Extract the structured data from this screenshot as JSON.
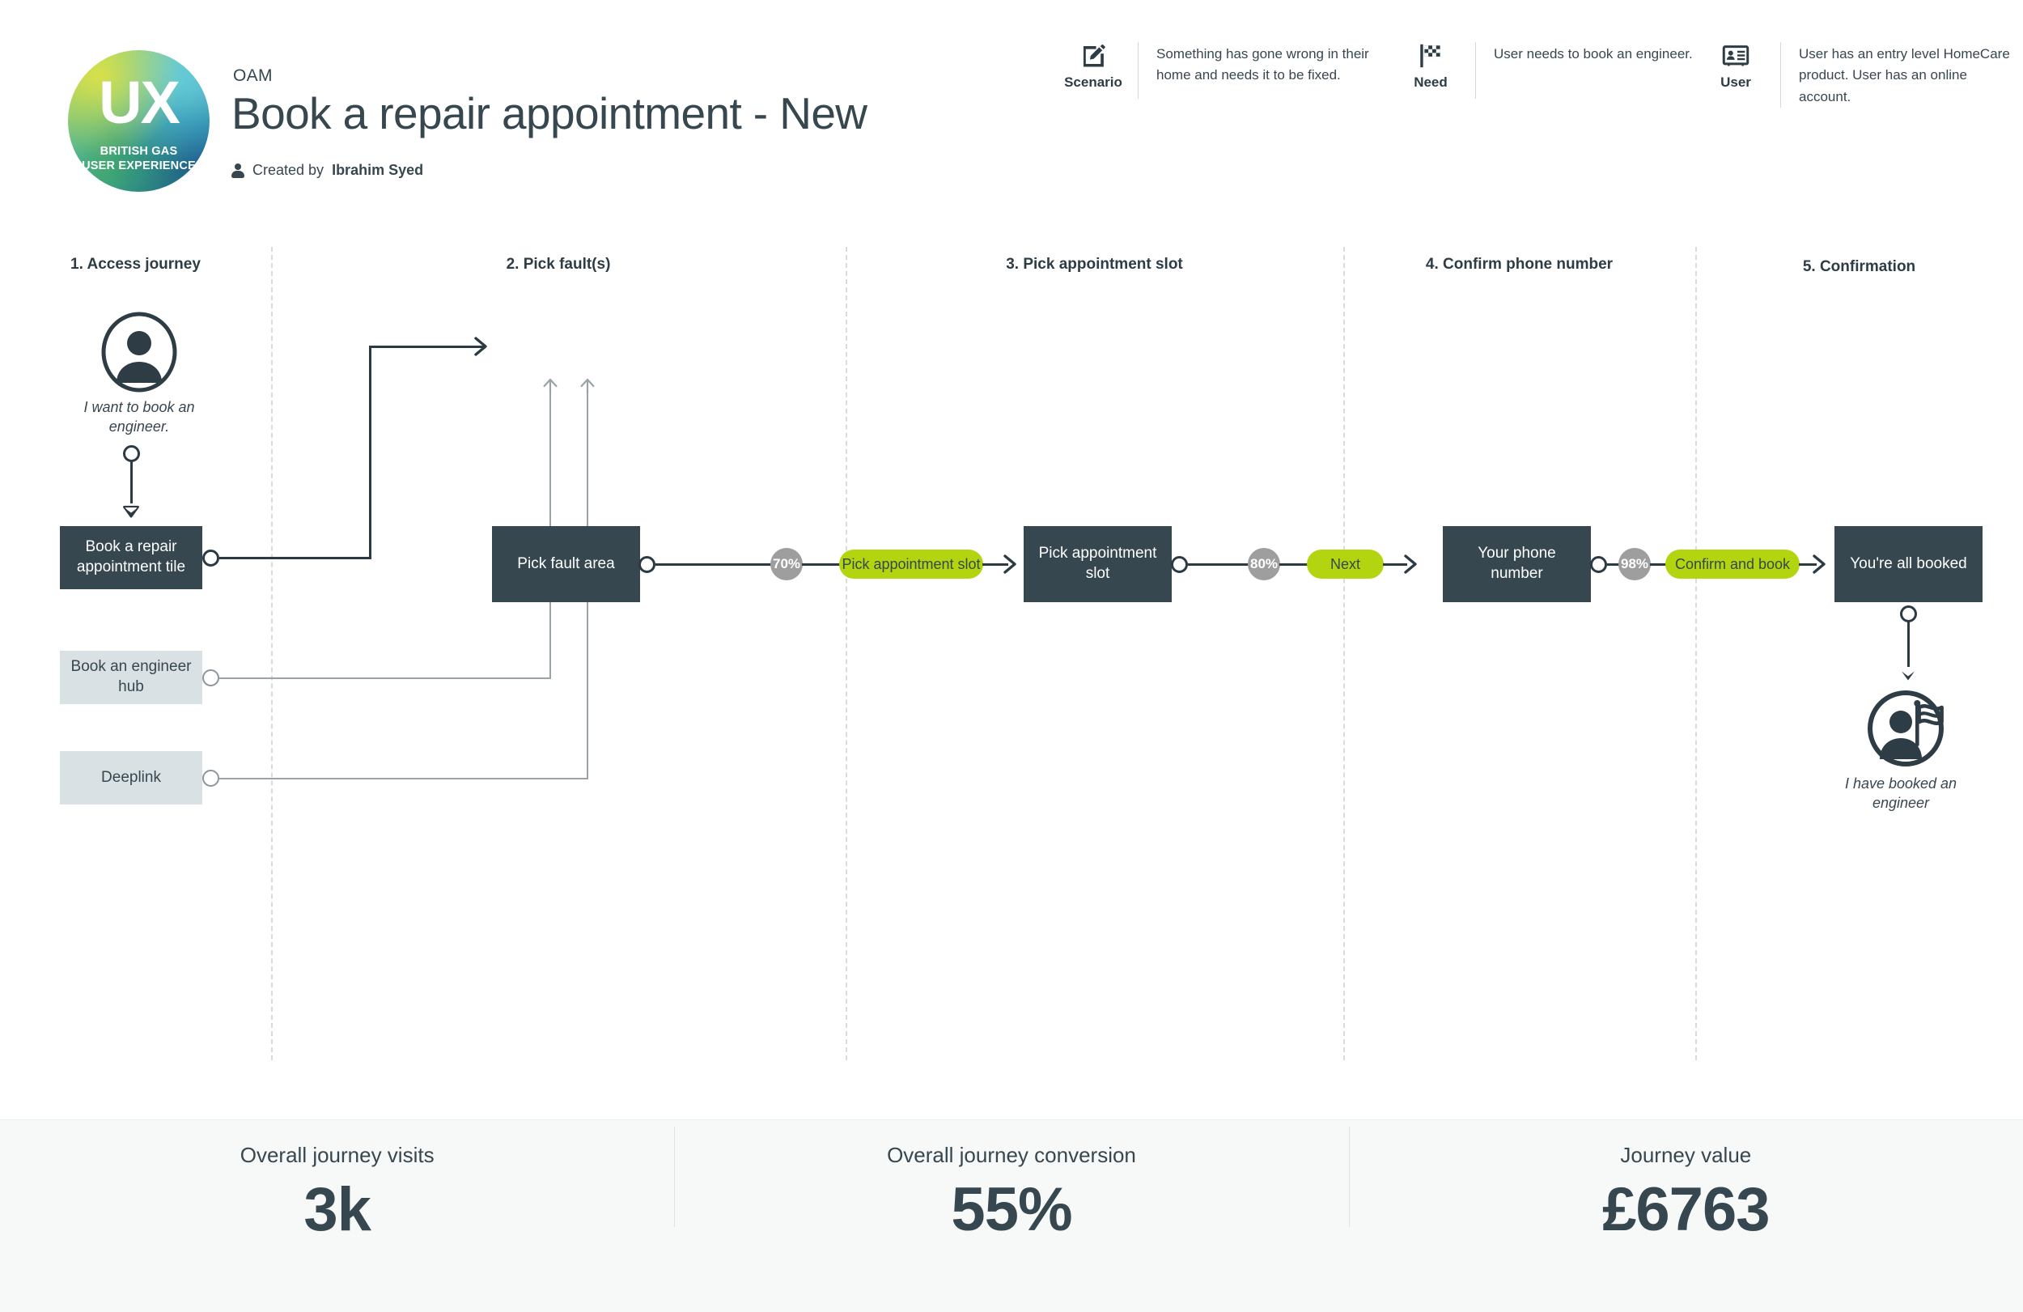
{
  "header": {
    "logo": {
      "mark": "UX",
      "line1": "BRITISH GAS",
      "line2": "USER EXPERIENCE"
    },
    "eyebrow": "OAM",
    "title": "Book a repair appointment - New",
    "created_prefix": "Created by",
    "created_by": "Ibrahim Syed",
    "meta": [
      {
        "icon": "pencil-edit-icon",
        "label": "Scenario",
        "text": "Something has gone wrong in their home and needs it to be fixed."
      },
      {
        "icon": "flag-icon",
        "label": "Need",
        "text": "User needs to book an engineer."
      },
      {
        "icon": "id-card-icon",
        "label": "User",
        "text": "User has an entry level HomeCare product. User has an online account."
      }
    ]
  },
  "stages": [
    {
      "label": "1. Access journey"
    },
    {
      "label": "2. Pick fault(s)"
    },
    {
      "label": "3. Pick appointment slot"
    },
    {
      "label": "4. Confirm phone number"
    },
    {
      "label": "5. Confirmation"
    }
  ],
  "personas": {
    "start": {
      "icon": "user-circle-icon",
      "caption": "I want to book an engineer."
    },
    "end": {
      "icon": "user-flag-circle-icon",
      "caption": "I have booked an engineer"
    }
  },
  "entry_points": [
    {
      "label": "Book a repair appointment tile",
      "style": "dark"
    },
    {
      "label": "Book an engineer hub",
      "style": "light"
    },
    {
      "label": "Deeplink",
      "style": "light"
    }
  ],
  "screens": [
    {
      "label": "Pick fault area"
    },
    {
      "label": "Pick appointment slot"
    },
    {
      "label": "Your phone number"
    },
    {
      "label": "You're all booked"
    }
  ],
  "actions": [
    {
      "label": "Pick appointment slot"
    },
    {
      "label": "Next"
    },
    {
      "label": "Confirm and book"
    }
  ],
  "conversions": [
    {
      "value": "70%"
    },
    {
      "value": "80%"
    },
    {
      "value": "98%"
    }
  ],
  "metrics": [
    {
      "label": "Overall journey visits",
      "value": "3k"
    },
    {
      "label": "Overall journey conversion",
      "value": "55%"
    },
    {
      "label": "Journey value",
      "value": "£6763"
    }
  ],
  "colors": {
    "dark": "#37474f",
    "light_box": "#d9e1e4",
    "action_green": "#b2d50f",
    "badge_gray": "#9e9e9e",
    "footer_bg": "#f7f8f8"
  }
}
